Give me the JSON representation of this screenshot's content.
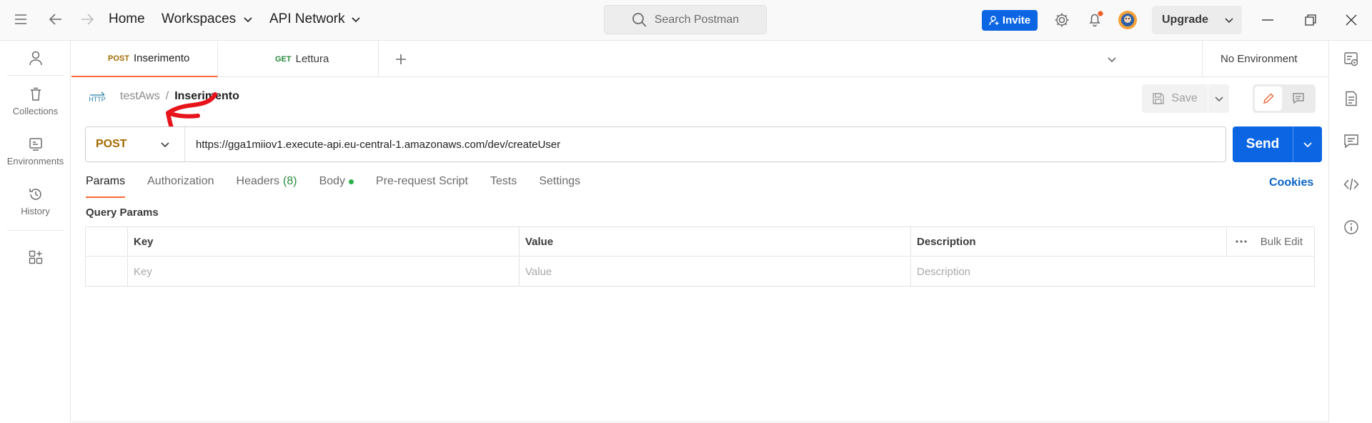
{
  "topbar": {
    "home_label": "Home",
    "workspaces_label": "Workspaces",
    "api_network_label": "API Network",
    "search_placeholder": "Search Postman",
    "invite_label": "Invite",
    "upgrade_label": "Upgrade"
  },
  "sidebar": {
    "items": [
      {
        "label": "Collections"
      },
      {
        "label": "Environments"
      },
      {
        "label": "History"
      }
    ]
  },
  "tabs": [
    {
      "method": "POST",
      "name": "Inserimento",
      "active": true
    },
    {
      "method": "GET",
      "name": "Lettura",
      "active": false
    }
  ],
  "environment": {
    "selected": "No Environment"
  },
  "breadcrumb": {
    "protocol": "HTTP",
    "collection": "testAws",
    "separator": "/",
    "request": "Inserimento"
  },
  "toolbar": {
    "save_label": "Save"
  },
  "request": {
    "method": "POST",
    "url": "https://gga1miiov1.execute-api.eu-central-1.amazonaws.com/dev/createUser",
    "send_label": "Send"
  },
  "subtabs": {
    "params": "Params",
    "authorization": "Authorization",
    "headers": "Headers",
    "headers_count": "(8)",
    "body": "Body",
    "prerequest": "Pre-request Script",
    "tests": "Tests",
    "settings": "Settings",
    "cookies": "Cookies"
  },
  "query_params": {
    "title": "Query Params",
    "columns": [
      "Key",
      "Value",
      "Description"
    ],
    "bulk_edit_label": "Bulk Edit",
    "placeholders": [
      "Key",
      "Value",
      "Description"
    ]
  },
  "colors": {
    "accent": "#0c66e4",
    "post_method": "#a36a00",
    "get_method": "#2a8c3c",
    "active_tab": "#ff6c37",
    "annotation": "#e8141b"
  }
}
